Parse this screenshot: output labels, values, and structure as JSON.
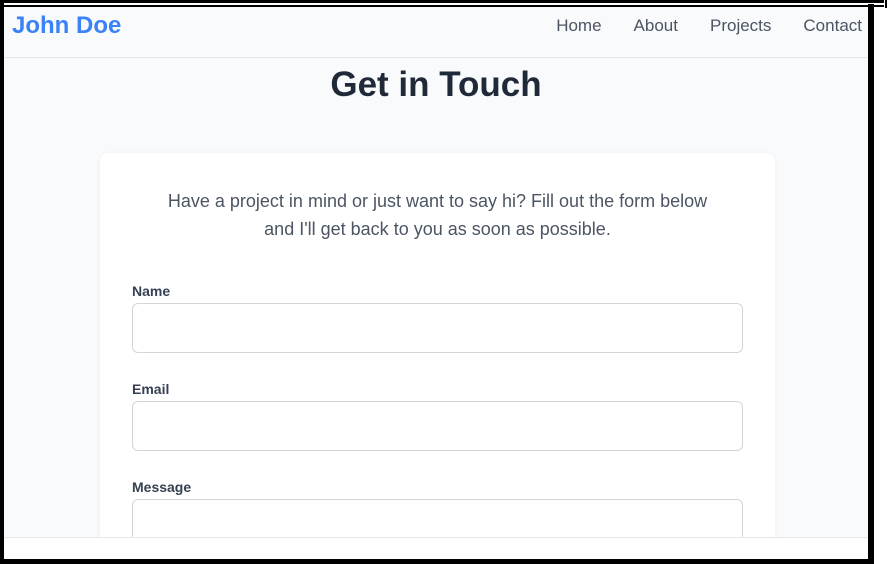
{
  "nav": {
    "brand": "John Doe",
    "links": [
      "Home",
      "About",
      "Projects",
      "Contact"
    ]
  },
  "page": {
    "title": "Get in Touch"
  },
  "card": {
    "intro_line1": "Have a project in mind or just want to say hi? Fill out the form below",
    "intro_line2": "and I'll get back to you as soon as possible.",
    "fields": {
      "name_label": "Name",
      "name_value": "",
      "email_label": "Email",
      "email_value": "",
      "message_label": "Message",
      "message_value": ""
    }
  },
  "colors": {
    "brand": "#3b82f6",
    "title": "#1f2937",
    "text": "#4b5563",
    "background": "#f8fafc",
    "card": "#ffffff",
    "border": "#d1d5db"
  }
}
